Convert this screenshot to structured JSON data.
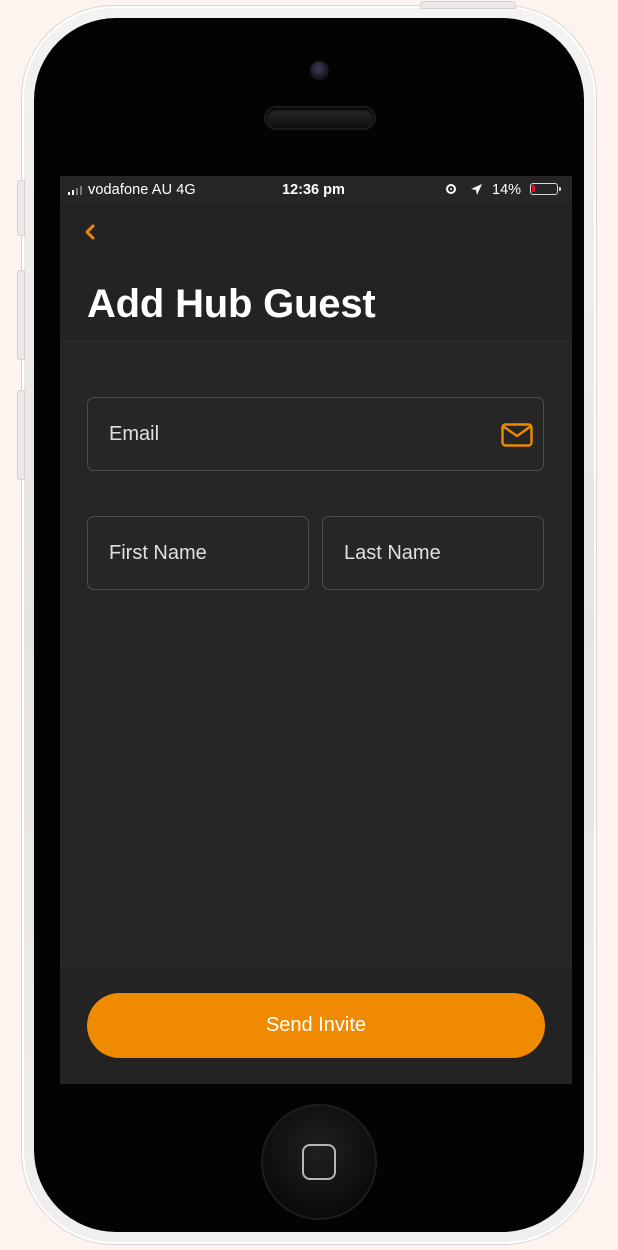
{
  "colors": {
    "accent": "#f08a00",
    "screen_background": "#262626",
    "battery_low": "#e3142a"
  },
  "status_bar": {
    "carrier": "vodafone AU   4G",
    "time": "12:36 pm",
    "battery_percent_label": "14%",
    "battery_level": 0.14,
    "icons": [
      "signal-icon",
      "orientation-lock-icon",
      "location-arrow-icon",
      "battery-icon"
    ]
  },
  "header": {
    "back_icon": "chevron-left-icon",
    "title": "Add Hub Guest"
  },
  "form": {
    "email_placeholder": "Email",
    "email_value": "",
    "email_icon": "mail-icon",
    "first_name_placeholder": "First Name",
    "first_name_value": "",
    "last_name_placeholder": "Last Name",
    "last_name_value": ""
  },
  "footer": {
    "send_button_label": "Send Invite"
  }
}
